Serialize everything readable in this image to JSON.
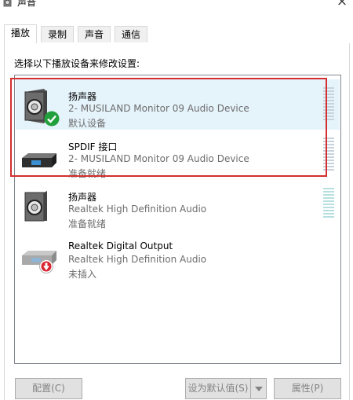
{
  "window": {
    "title": "声音",
    "icon": "speaker-icon",
    "close_label": "×"
  },
  "tabs": [
    {
      "label": "播放",
      "active": true
    },
    {
      "label": "录制",
      "active": false
    },
    {
      "label": "声音",
      "active": false
    },
    {
      "label": "通信",
      "active": false
    }
  ],
  "instruction": "选择以下播放设备来修改设置:",
  "devices": [
    {
      "name": "扬声器",
      "description": "2- MUSILAND Monitor 09 Audio Device",
      "status": "默认设备",
      "icon": "speaker-default-icon",
      "badge": "green-check-icon"
    },
    {
      "name": "SPDIF 接口",
      "description": "2- MUSILAND Monitor 09 Audio Device",
      "status": "准备就绪",
      "icon": "spdif-port-icon"
    },
    {
      "name": "扬声器",
      "description": "Realtek High Definition Audio",
      "status": "准备就绪",
      "icon": "speaker-icon"
    },
    {
      "name": "Realtek Digital Output",
      "description": "Realtek High Definition Audio",
      "status": "未插入",
      "icon": "digital-output-icon",
      "badge": "red-unplugged-icon"
    }
  ],
  "buttons": {
    "configure": "配置(C)",
    "set_default": "设为默认值(S)",
    "properties": "属性(P)"
  },
  "colors": {
    "highlight": "#d32f2f",
    "selection": "#e5f3fb",
    "check": "#22a03b",
    "unplugged": "#d9232e"
  }
}
